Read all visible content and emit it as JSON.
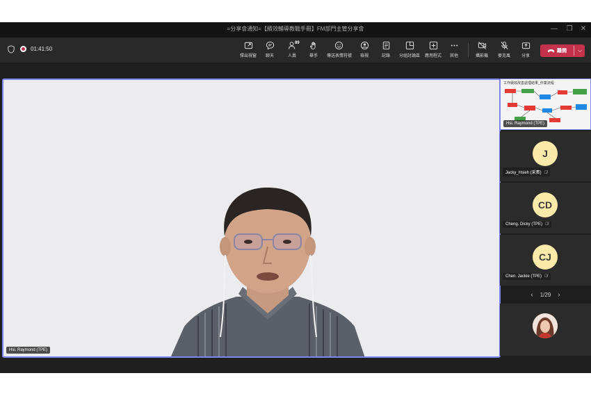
{
  "window": {
    "title": "=分享會通知=【績效輔導教戰手冊】FM部門主管分享會"
  },
  "toolbar": {
    "timer": "01:41:50",
    "buttons": [
      {
        "label": "彈出視窗",
        "icon": "pop-out-icon"
      },
      {
        "label": "聊天",
        "icon": "chat-icon"
      },
      {
        "label": "人員",
        "icon": "people-icon",
        "badge": "89"
      },
      {
        "label": "舉手",
        "icon": "raise-hand-icon"
      },
      {
        "label": "傳送表情符號",
        "icon": "emoji-icon"
      },
      {
        "label": "檢視",
        "icon": "view-icon"
      },
      {
        "label": "記錄",
        "icon": "notes-icon"
      },
      {
        "label": "分組討論區",
        "icon": "breakout-rooms-icon"
      },
      {
        "label": "應用程式",
        "icon": "apps-icon"
      },
      {
        "label": "其他",
        "icon": "more-icon"
      },
      {
        "label": "攝影機",
        "icon": "camera-off-icon"
      },
      {
        "label": "麥克風",
        "icon": "mic-off-icon"
      },
      {
        "label": "分享",
        "icon": "share-icon"
      }
    ],
    "leave_label": "離開"
  },
  "stage": {
    "name": "Hsi. Raymond (TPE)"
  },
  "rail": {
    "shared_slide": {
      "name": "Hsi. Raymond (TPE)",
      "slide_title": "工作績效改善處理結果_作業流程"
    },
    "participants": [
      {
        "initials": "J",
        "name": "Jacky_Hsieh (采賓)"
      },
      {
        "initials": "CD",
        "name": "Cheng. Dicky (TPE)"
      },
      {
        "initials": "CJ",
        "name": "Chen. Jackie (TPE)"
      }
    ],
    "pager": "1/29"
  },
  "colors": {
    "accent": "#7f85f5",
    "leave": "#c4314b",
    "avatar_bg": "#fbeaa9",
    "background": "#1f1f1f"
  }
}
